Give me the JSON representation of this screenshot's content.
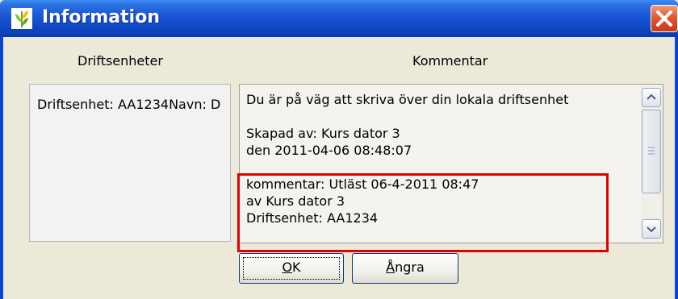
{
  "window": {
    "title": "Information"
  },
  "columns": {
    "left_header": "Driftsenheter",
    "right_header": "Kommentar"
  },
  "left_panel": {
    "items": [
      "Driftsenhet: AA1234Navn: D"
    ]
  },
  "comment": {
    "lines": [
      "Du är på väg att skriva över din lokala driftsenhet",
      "",
      "Skapad av: Kurs dator 3",
      "den 2011-04-06 08:48:07",
      "",
      "kommentar: Utläst 06-4-2011 08:47",
      "av Kurs dator 3",
      "Driftsenhet: AA1234"
    ]
  },
  "buttons": {
    "ok": {
      "mnemonic": "O",
      "rest": "K"
    },
    "cancel": {
      "mnemonic": "Å",
      "rest": "ngra"
    }
  },
  "colors": {
    "highlight": "#e00000",
    "titlebar": "#0f47c2",
    "close": "#e1582f"
  },
  "icons": {
    "app": "wheat-leaf-icon",
    "close": "close-icon",
    "scroll_up": "chevron-up-icon",
    "scroll_down": "chevron-down-icon",
    "thumb_grip": "grip-icon"
  }
}
